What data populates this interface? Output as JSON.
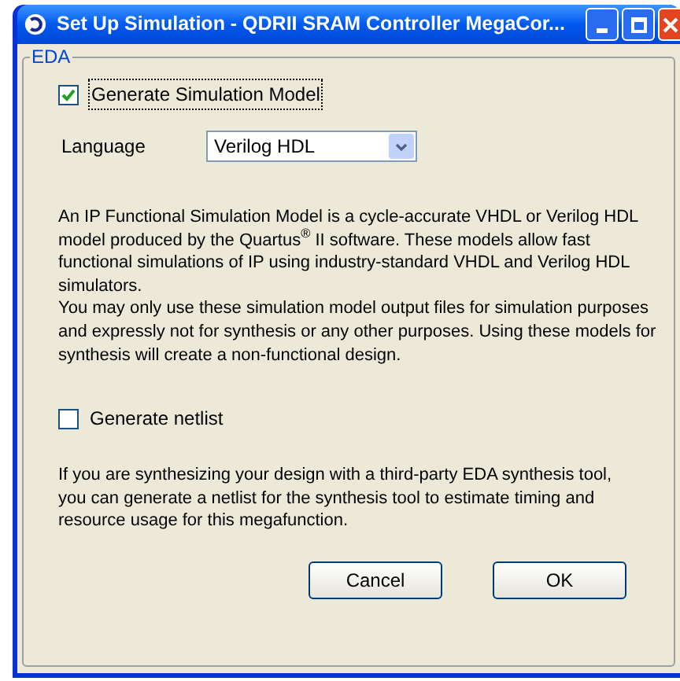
{
  "window": {
    "title": "Set Up Simulation - QDRII SRAM Controller MegaCor..."
  },
  "group": {
    "title": "EDA"
  },
  "generate_model": {
    "label": "Generate Simulation Model",
    "checked": true
  },
  "language": {
    "label": "Language",
    "value": "Verilog HDL"
  },
  "description": [
    "An IP Functional Simulation Model is a cycle-accurate VHDL or Verilog HDL model produced by the Quartus$^{®}$ II software. These models allow fast functional simulations of IP using industry-standard VHDL and Verilog HDL simulators.",
    "You may only use these simulation model output files for simulation purposes and expressly not for synthesis or any other purposes. Using these models for synthesis will create a non-functional design."
  ],
  "generate_netlist": {
    "label": "Generate netlist",
    "checked": false
  },
  "netlist_note": "If you are synthesizing your design with a third-party EDA synthesis tool, you can generate a netlist for the synthesis tool to estimate timing and resource usage for this megafunction.",
  "buttons": [
    "Cancel",
    "OK"
  ]
}
